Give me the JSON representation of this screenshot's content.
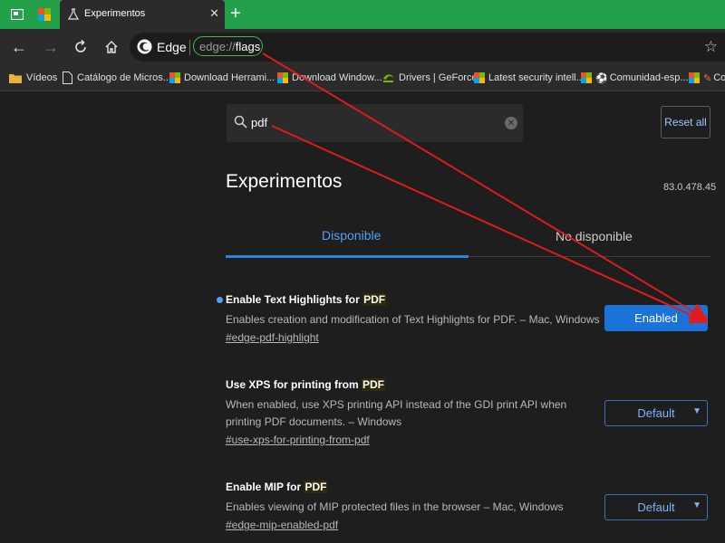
{
  "browser": {
    "tab": {
      "title": "Experimentos",
      "close": "✕"
    },
    "new_tab": "+",
    "address": {
      "brand": "Edge",
      "scheme": "edge://",
      "host": "flags"
    },
    "bookmarks": [
      {
        "label": "Vídeos",
        "icon": "folder-icon"
      },
      {
        "label": "Catálogo de Micros...",
        "icon": "page-icon"
      },
      {
        "label": "Download Herrami...",
        "icon": "microsoft-logo-icon"
      },
      {
        "label": "Download Window...",
        "icon": "microsoft-logo-icon"
      },
      {
        "label": "Drivers | GeForce",
        "icon": "nvidia-icon"
      },
      {
        "label": "Latest security intell...",
        "icon": "microsoft-logo-icon"
      },
      {
        "label": "Comunidad-esp...",
        "icon": "microsoft-logo-icon"
      },
      {
        "label": "Co",
        "icon": "microsoft-logo-icon"
      }
    ]
  },
  "page": {
    "search": {
      "value": "pdf"
    },
    "reset_label": "Reset all",
    "title": "Experimentos",
    "version": "83.0.478.45",
    "tabs": {
      "available": "Disponible",
      "unavailable": "No disponible"
    },
    "flags": [
      {
        "title_pre": "Enable Text Highlights for ",
        "title_hl": "PDF",
        "desc": "Enables creation and modification of Text Highlights for PDF. – Mac, Windows",
        "link": "#edge-pdf-highlight",
        "value": "Enabled",
        "modified": true
      },
      {
        "title_pre": "Use XPS for printing from ",
        "title_hl": "PDF",
        "desc": "When enabled, use XPS printing API instead of the GDI print API when printing PDF documents. – Windows",
        "link": "#use-xps-for-printing-from-pdf",
        "value": "Default",
        "modified": false
      },
      {
        "title_pre": "Enable MIP for ",
        "title_hl": "PDF",
        "desc": "Enables viewing of MIP protected files in the browser – Mac, Windows",
        "link": "#edge-mip-enabled-pdf",
        "value": "Default",
        "modified": false
      }
    ]
  },
  "colors": {
    "titlebar": "#23a04a",
    "accent": "#2f83e0",
    "arrow": "#e01b1b",
    "url_highlight": "#45b649"
  }
}
